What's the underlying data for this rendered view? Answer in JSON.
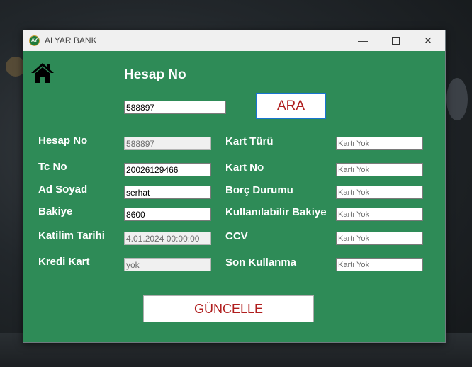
{
  "window": {
    "title": "ALYAR BANK",
    "icon_text": "AY",
    "controls": {
      "minimize": "—",
      "close": "✕"
    }
  },
  "search": {
    "heading": "Hesap No",
    "value": "588897",
    "button_label": "ARA"
  },
  "account_fields": [
    {
      "label": "Hesap No",
      "value": "588897",
      "readonly": true
    },
    {
      "label": "Tc No",
      "value": "20026129466",
      "readonly": false
    },
    {
      "label": "Ad Soyad",
      "value": "serhat",
      "readonly": false
    },
    {
      "label": "Bakiye",
      "value": "8600",
      "readonly": false
    },
    {
      "label": "Katilim Tarihi",
      "value": "4.01.2024 00:00:00",
      "readonly": true
    },
    {
      "label": "Kredi Kart",
      "value": "yok",
      "readonly": true
    }
  ],
  "card_fields": [
    {
      "label": "Kart Türü",
      "value": "Kartı Yok"
    },
    {
      "label": "Kart No",
      "value": "Kartı Yok"
    },
    {
      "label": "Borç Durumu",
      "value": "Kartı Yok"
    },
    {
      "label": "Kullanılabilir Bakiye",
      "value": "Kartı Yok"
    },
    {
      "label": "CCV",
      "value": "Kartı Yok"
    },
    {
      "label": "Son Kullanma",
      "value": "Kartı Yok"
    }
  ],
  "update_button_label": "GÜNCELLE",
  "colors": {
    "form_background": "#2e8b57",
    "button_text": "#b01e1e",
    "search_button_border": "#1874d0"
  },
  "icons": {
    "home": "home-icon"
  }
}
